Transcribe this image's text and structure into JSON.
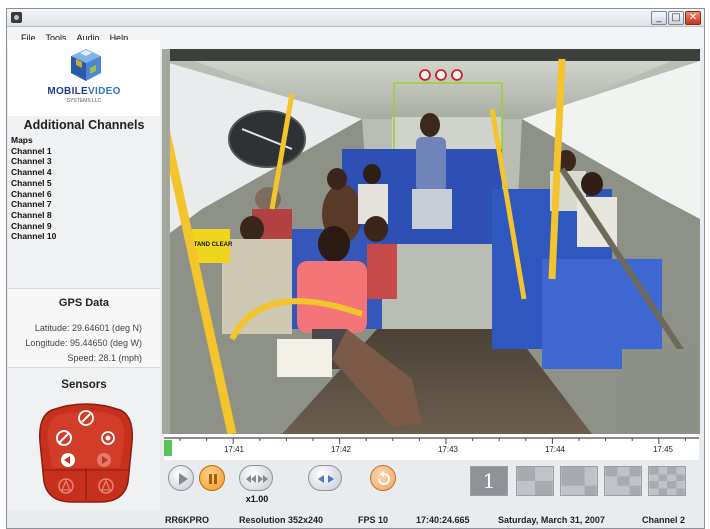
{
  "menu": [
    "File",
    "Tools",
    "Audio",
    "Help"
  ],
  "window_buttons": {
    "minimize": "_",
    "maximize": "□",
    "close": "✕"
  },
  "logo": {
    "main_a": "MOBILE",
    "main_b": "VIDEO",
    "sub": "SYSTEMS LLC"
  },
  "sidebar": {
    "title": "Additional Channels",
    "channels": [
      "Maps",
      "Channel 1",
      "Channel 3",
      "Channel 4",
      "Channel 5",
      "Channel 6",
      "Channel 7",
      "Channel 8",
      "Channel 9",
      "Channel 10"
    ]
  },
  "gps": {
    "title": "GPS Data",
    "latitude": "Latitude: 29.64601 (deg N)",
    "longitude": "Longitude: 95.44650 (deg W)",
    "speed": "Speed: 28.1 (mph)"
  },
  "sensors": {
    "title": "Sensors"
  },
  "video": {
    "overlay_sign": "STAND CLEAR"
  },
  "timeline": {
    "ticks": [
      "17:41",
      "17:42",
      "17:43",
      "17:44",
      "17:45"
    ]
  },
  "controls": {
    "speed": "x1.00",
    "layout_single": "1"
  },
  "status": {
    "device": "RR6KPRO",
    "resolution": "Resolution 352x240",
    "fps": "FPS 10",
    "time": "17:40:24.665",
    "date": "Saturday, March 31, 2007",
    "channel": "Channel 2"
  },
  "colors": {
    "accent_blue": "#2e74c9",
    "sensor_red": "#c8301e",
    "pause_orange": "#f39a1e"
  }
}
